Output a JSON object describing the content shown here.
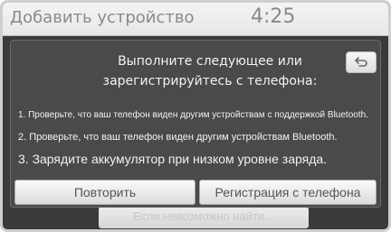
{
  "header": {
    "title": "Добавить устройство",
    "time": "4:25"
  },
  "dialog": {
    "heading_line1": "Выполните следующее или",
    "heading_line2": "зарегистрируйтесь с телефона:",
    "back_icon": "return-arrow-icon",
    "steps": [
      "1. Проверьте, что ваш телефон виден другим устройствам с поддержкой Bluetooth.",
      "2. Проверьте, что ваш телефон виден другим устройствам Bluetooth.",
      "3. Зарядите аккумулятор при низком уровне заряда."
    ],
    "retry_label": "Повторить",
    "register_label": "Регистрация с телефона"
  },
  "background": {
    "hint_text": "Если невозможно найти..."
  }
}
